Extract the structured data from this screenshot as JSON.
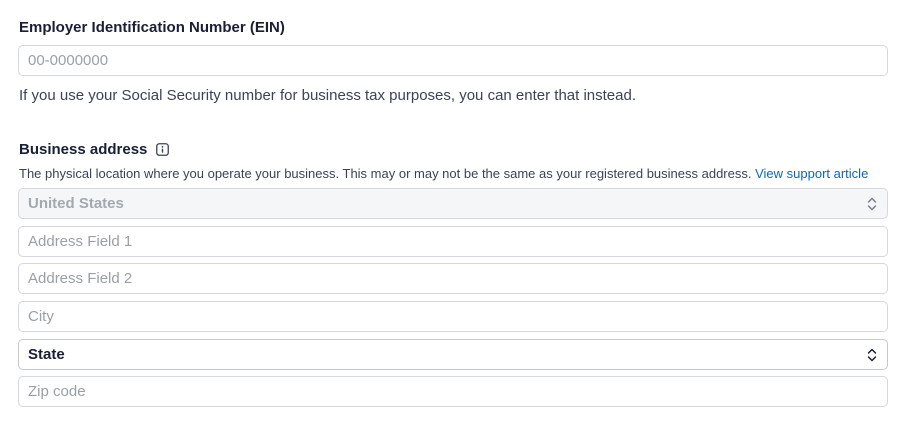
{
  "ein": {
    "label": "Employer Identification Number (EIN)",
    "placeholder": "00-0000000",
    "help": "If you use your Social Security number for business tax purposes, you can enter that instead."
  },
  "address": {
    "label": "Business address",
    "info_icon": "info-icon",
    "help": "The physical location where you operate your business. This may or may not be the same as your registered business address.",
    "support_link": "View support article",
    "country": "United States",
    "address1_placeholder": "Address Field 1",
    "address2_placeholder": "Address Field 2",
    "city_placeholder": "City",
    "state": "State",
    "zip_placeholder": "Zip code"
  },
  "colors": {
    "link": "#0a66c2",
    "border": "#d5d8dc",
    "placeholder": "#9aa0a8"
  }
}
